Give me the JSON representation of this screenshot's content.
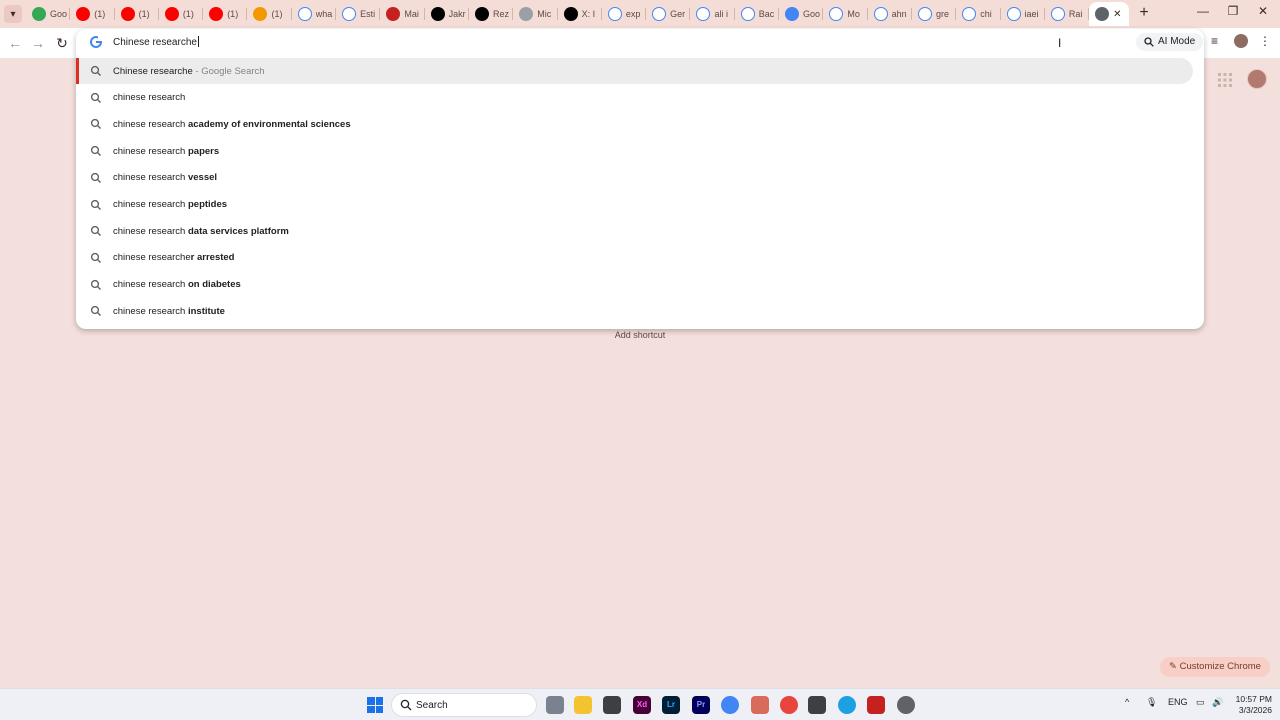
{
  "tabs": [
    {
      "title": "Goo",
      "icon": "maps-pin-icon",
      "color": "#34a853"
    },
    {
      "title": "(1) ",
      "icon": "youtube-icon",
      "color": "#ff0000"
    },
    {
      "title": "(1) ",
      "icon": "youtube-icon",
      "color": "#ff0000"
    },
    {
      "title": "(1) ",
      "icon": "youtube-icon",
      "color": "#ff0000"
    },
    {
      "title": "(1) ",
      "icon": "youtube-icon",
      "color": "#ff0000"
    },
    {
      "title": "(1) ",
      "icon": "orange-app-icon",
      "color": "#f29900"
    },
    {
      "title": "wha",
      "icon": "google-icon",
      "color": "#ffffff"
    },
    {
      "title": "Esti",
      "icon": "google-icon",
      "color": "#ffffff"
    },
    {
      "title": "Mai",
      "icon": "mail-icon",
      "color": "#c5221f"
    },
    {
      "title": "Jakr",
      "icon": "x-icon",
      "color": "#000000"
    },
    {
      "title": "Rez",
      "icon": "x-icon",
      "color": "#000000"
    },
    {
      "title": "Mic",
      "icon": "spinner-icon",
      "color": "#9aa0a6"
    },
    {
      "title": "X: I",
      "icon": "x-icon",
      "color": "#000000"
    },
    {
      "title": "exp",
      "icon": "google-icon",
      "color": "#ffffff"
    },
    {
      "title": "Ger",
      "icon": "google-icon",
      "color": "#ffffff"
    },
    {
      "title": "ali i",
      "icon": "google-icon",
      "color": "#ffffff"
    },
    {
      "title": "Bac",
      "icon": "google-icon",
      "color": "#ffffff"
    },
    {
      "title": "Goo",
      "icon": "gemini-icon",
      "color": "#4285f4"
    },
    {
      "title": "Mo",
      "icon": "google-icon",
      "color": "#ffffff"
    },
    {
      "title": "ahn",
      "icon": "google-icon",
      "color": "#ffffff"
    },
    {
      "title": "gre",
      "icon": "google-icon",
      "color": "#ffffff"
    },
    {
      "title": "chi",
      "icon": "google-icon",
      "color": "#ffffff"
    },
    {
      "title": "iaei",
      "icon": "google-icon",
      "color": "#ffffff"
    },
    {
      "title": "Rai",
      "icon": "google-icon",
      "color": "#ffffff"
    }
  ],
  "omnibox": {
    "query": "Chinese researche",
    "ai_mode_label": "AI Mode",
    "suggestions": [
      {
        "prefix": "Chinese researche",
        "bold": "",
        "hint": " - Google Search",
        "selected": true
      },
      {
        "prefix": "chinese research",
        "bold": "",
        "hint": "",
        "selected": false
      },
      {
        "prefix": "chinese research ",
        "bold": "academy of environmental sciences",
        "hint": "",
        "selected": false
      },
      {
        "prefix": "chinese research ",
        "bold": "papers",
        "hint": "",
        "selected": false
      },
      {
        "prefix": "chinese research ",
        "bold": "vessel",
        "hint": "",
        "selected": false
      },
      {
        "prefix": "chinese research ",
        "bold": "peptides",
        "hint": "",
        "selected": false
      },
      {
        "prefix": "chinese research ",
        "bold": "data services platform",
        "hint": "",
        "selected": false
      },
      {
        "prefix": "chinese researche",
        "bold": "r arrested",
        "hint": "",
        "selected": false
      },
      {
        "prefix": "chinese research ",
        "bold": "on diabetes",
        "hint": "",
        "selected": false
      },
      {
        "prefix": "chinese research ",
        "bold": "institute",
        "hint": "",
        "selected": false
      }
    ]
  },
  "ntp": {
    "add_shortcut": "Add shortcut",
    "customize": "Customize Chrome"
  },
  "taskbar": {
    "search_label": "Search",
    "language": "ENG",
    "time": "10:57 PM",
    "date": "3/3/2026"
  },
  "colors": {
    "page_bg": "#f3dfdb",
    "selected_bar": "#d93025"
  }
}
